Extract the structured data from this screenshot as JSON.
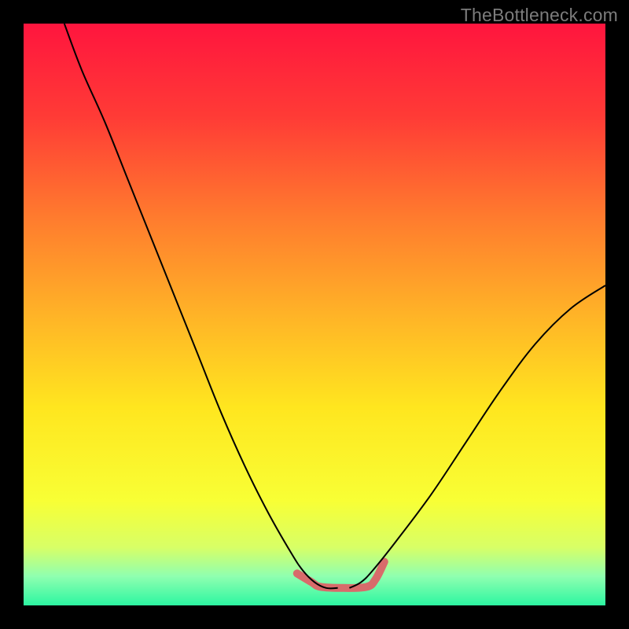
{
  "watermark": {
    "text": "TheBottleneck.com"
  },
  "chart_data": {
    "type": "line",
    "title": "",
    "xlabel": "",
    "ylabel": "",
    "xlim": [
      0,
      100
    ],
    "ylim": [
      0,
      100
    ],
    "grid": false,
    "legend": false,
    "background_gradient_stops": [
      {
        "offset": 0.0,
        "color": "#ff153e"
      },
      {
        "offset": 0.16,
        "color": "#ff3b36"
      },
      {
        "offset": 0.33,
        "color": "#ff7a2e"
      },
      {
        "offset": 0.5,
        "color": "#ffb327"
      },
      {
        "offset": 0.66,
        "color": "#ffe61f"
      },
      {
        "offset": 0.82,
        "color": "#f8ff35"
      },
      {
        "offset": 0.9,
        "color": "#d8ff66"
      },
      {
        "offset": 0.95,
        "color": "#8fffb0"
      },
      {
        "offset": 1.0,
        "color": "#2cf6a1"
      }
    ],
    "series": [
      {
        "name": "left-curve",
        "stroke": "#000000",
        "stroke_width": 2,
        "x": [
          7,
          10,
          14,
          18,
          22,
          26,
          30,
          34,
          38,
          42,
          46,
          48,
          50,
          52,
          54
        ],
        "y": [
          100,
          92,
          83,
          73,
          63,
          53,
          43,
          33,
          24,
          16,
          9,
          6,
          4,
          3,
          3
        ]
      },
      {
        "name": "right-curve",
        "stroke": "#000000",
        "stroke_width": 2,
        "x": [
          56,
          58,
          60,
          64,
          70,
          76,
          82,
          88,
          94,
          100
        ],
        "y": [
          3,
          4,
          6,
          11,
          19,
          28,
          37,
          45,
          51,
          55
        ]
      },
      {
        "name": "bottom-highlight",
        "stroke": "#d86b6b",
        "stroke_width": 10,
        "linecap": "round",
        "x": [
          47,
          49.5,
          51,
          55,
          59,
          60.5,
          62
        ],
        "y": [
          5.5,
          4.0,
          3.2,
          3.0,
          3.2,
          4.5,
          7.5
        ]
      }
    ]
  }
}
